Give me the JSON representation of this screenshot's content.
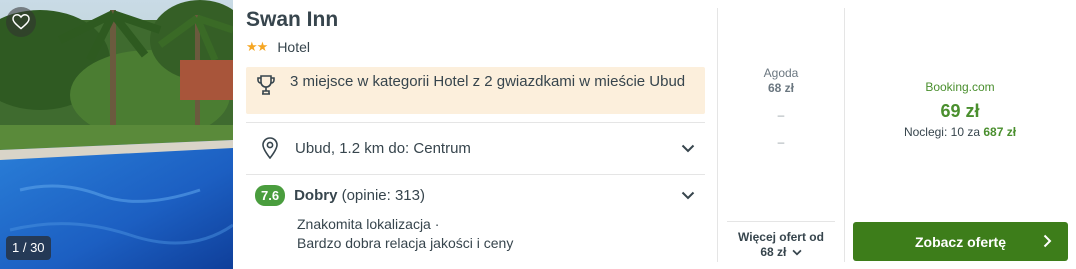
{
  "hotel": {
    "name": "Swan Inn",
    "stars": "★★",
    "category": "Hotel",
    "photo_counter": "1 / 30",
    "award": "3 miejsce w kategorii Hotel z 2 gwiazdkami w mieście Ubud",
    "location": "Ubud, 1.2 km do: Centrum",
    "rating": {
      "score": "7.6",
      "label": "Dobry",
      "count_text": "(opinie: 313)",
      "highlight_1": "Znakomita lokalizacja ·",
      "highlight_2": "Bardzo dobra relacja jakości i ceny"
    }
  },
  "offers": {
    "secondary": {
      "provider": "Agoda",
      "price": "68 zł",
      "dash_1": "–",
      "dash_2": "–",
      "more_label": "Więcej ofert od",
      "more_price": "68 zł"
    },
    "best": {
      "provider": "Booking.com",
      "price": "69 zł",
      "nights_prefix": "Noclegi: 10 za",
      "nights_total": "687 zł",
      "cta_label": "Zobacz ofertę"
    }
  },
  "colors": {
    "accent_green": "#3d7d1a",
    "price_green": "#4a8f2e",
    "rating_green": "#4a9d3e",
    "star_orange": "#f5a623",
    "award_bg": "#fcefdc"
  },
  "icons": [
    "heart-icon",
    "trophy-icon",
    "map-pin-icon",
    "chevron-down-icon",
    "chevron-right-icon"
  ]
}
